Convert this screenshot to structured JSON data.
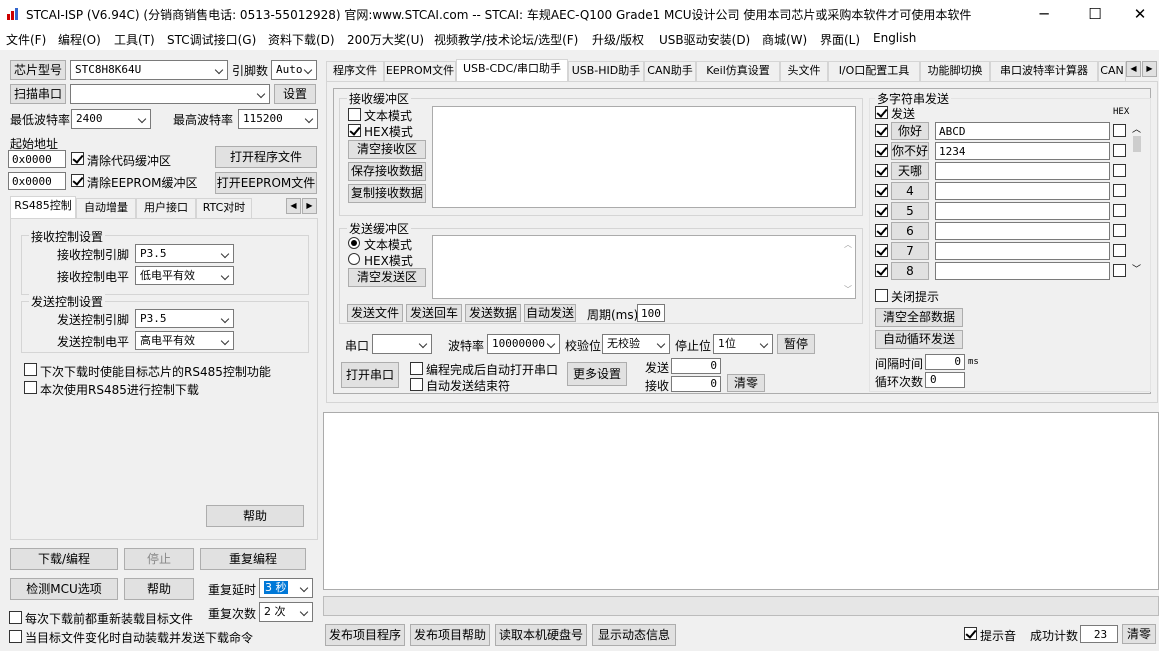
{
  "titlebar": {
    "title": "STCAI-ISP (V6.94C) (分销商销售电话: 0513-55012928) 官网:www.STCAI.com  -- STCAI: 车规AEC-Q100 Grade1 MCU设计公司 使用本司芯片或采购本软件才可使用本软件",
    "minimize": "─",
    "maximize": "☐",
    "close": "✕"
  },
  "menu": [
    "文件(F)",
    "编程(O)",
    "工具(T)",
    "STC调试接口(G)",
    "资料下载(D)",
    "200万大奖(U)",
    "视频教学/技术论坛/选型(F)",
    "升级/版权",
    "USB驱动安装(D)",
    "商城(W)",
    "界面(L)",
    "English"
  ],
  "left": {
    "chip_btn": "芯片型号",
    "chip_value": "STC8H8K64U",
    "pins_label": "引脚数",
    "pins_value": "Auto",
    "scan_btn": "扫描串口",
    "port_value": "",
    "settings_btn": "设置",
    "min_baud_label": "最低波特率",
    "min_baud": "2400",
    "max_baud_label": "最高波特率",
    "max_baud": "115200",
    "start_addr_label": "起始地址",
    "addr1": "0x0000",
    "clear_code": "清除代码缓冲区",
    "open_prog": "打开程序文件",
    "addr2": "0x0000",
    "clear_eeprom": "清除EEPROM缓冲区",
    "open_eeprom": "打开EEPROM文件",
    "tabs": [
      "RS485控制",
      "自动增量",
      "用户接口",
      "RTC对时"
    ],
    "rx_group": "接收控制设置",
    "rx_pin_label": "接收控制引脚",
    "rx_pin": "P3.5",
    "rx_level_label": "接收控制电平",
    "rx_level": "低电平有效",
    "tx_group": "发送控制设置",
    "tx_pin_label": "发送控制引脚",
    "tx_pin": "P3.5",
    "tx_level_label": "发送控制电平",
    "tx_level": "高电平有效",
    "opt1": "下次下载时使能目标芯片的RS485控制功能",
    "opt2": "本次使用RS485进行控制下载",
    "help_btn": "帮助",
    "download_btn": "下载/编程",
    "stop_btn": "停止",
    "reprog_btn": "重复编程",
    "check_btn": "检测MCU选项",
    "help2_btn": "帮助",
    "delay_label": "重复延时",
    "delay_value": "3 秒",
    "count_label": "重复次数",
    "count_value": "2 次",
    "opt3": "每次下载前都重新装载目标文件",
    "opt4": "当目标文件变化时自动装载并发送下载命令"
  },
  "right": {
    "tabs": [
      "程序文件",
      "EEPROM文件",
      "USB-CDC/串口助手",
      "USB-HID助手",
      "CAN助手",
      "Keil仿真设置",
      "头文件",
      "I/O口配置工具",
      "功能脚切换",
      "串口波特率计算器",
      "CAN"
    ],
    "rx_group": "接收缓冲区",
    "rx_text_mode": "文本模式",
    "rx_hex_mode": "HEX模式",
    "clear_rx": "清空接收区",
    "save_rx": "保存接收数据",
    "copy_rx": "复制接收数据",
    "tx_group": "发送缓冲区",
    "tx_text_mode": "文本模式",
    "tx_hex_mode": "HEX模式",
    "clear_tx": "清空发送区",
    "send_file": "发送文件",
    "send_back": "发送回车",
    "send_data": "发送数据",
    "auto_send": "自动发送",
    "period_label": "周期(ms)",
    "period_value": "100",
    "port_label": "串口",
    "port_value": "",
    "baud_label": "波特率",
    "baud_value": "10000000",
    "parity_label": "校验位",
    "parity_value": "无校验",
    "stop_label": "停止位",
    "stop_value": "1位",
    "pause_btn": "暂停",
    "open_port": "打开串口",
    "auto_open": "编程完成后自动打开串口",
    "auto_end": "自动发送结束符",
    "more_settings": "更多设置",
    "sent_label": "发送",
    "sent_value": "0",
    "recv_label": "接收",
    "recv_value": "0",
    "clear_count": "清零",
    "multi_group": "多字符串发送",
    "send_col": "发送",
    "hex_col": "HEX",
    "multi": [
      {
        "label": "你好",
        "value": "ABCD"
      },
      {
        "label": "你不好",
        "value": "1234"
      },
      {
        "label": "天哪",
        "value": ""
      },
      {
        "label": "4",
        "value": ""
      },
      {
        "label": "5",
        "value": ""
      },
      {
        "label": "6",
        "value": ""
      },
      {
        "label": "7",
        "value": ""
      },
      {
        "label": "8",
        "value": ""
      }
    ],
    "close_tip": "关闭提示",
    "clear_all": "清空全部数据",
    "auto_loop": "自动循环发送",
    "interval_label": "间隔时间",
    "interval_value": "0",
    "interval_unit": "ms",
    "loop_label": "循环次数",
    "loop_value": "0"
  },
  "bottom": {
    "publish_prog": "发布项目程序",
    "publish_help": "发布项目帮助",
    "read_disk": "读取本机硬盘号",
    "show_info": "显示动态信息",
    "prompt_sound": "提示音",
    "success_label": "成功计数",
    "success_value": "23",
    "clear_btn": "清零"
  }
}
